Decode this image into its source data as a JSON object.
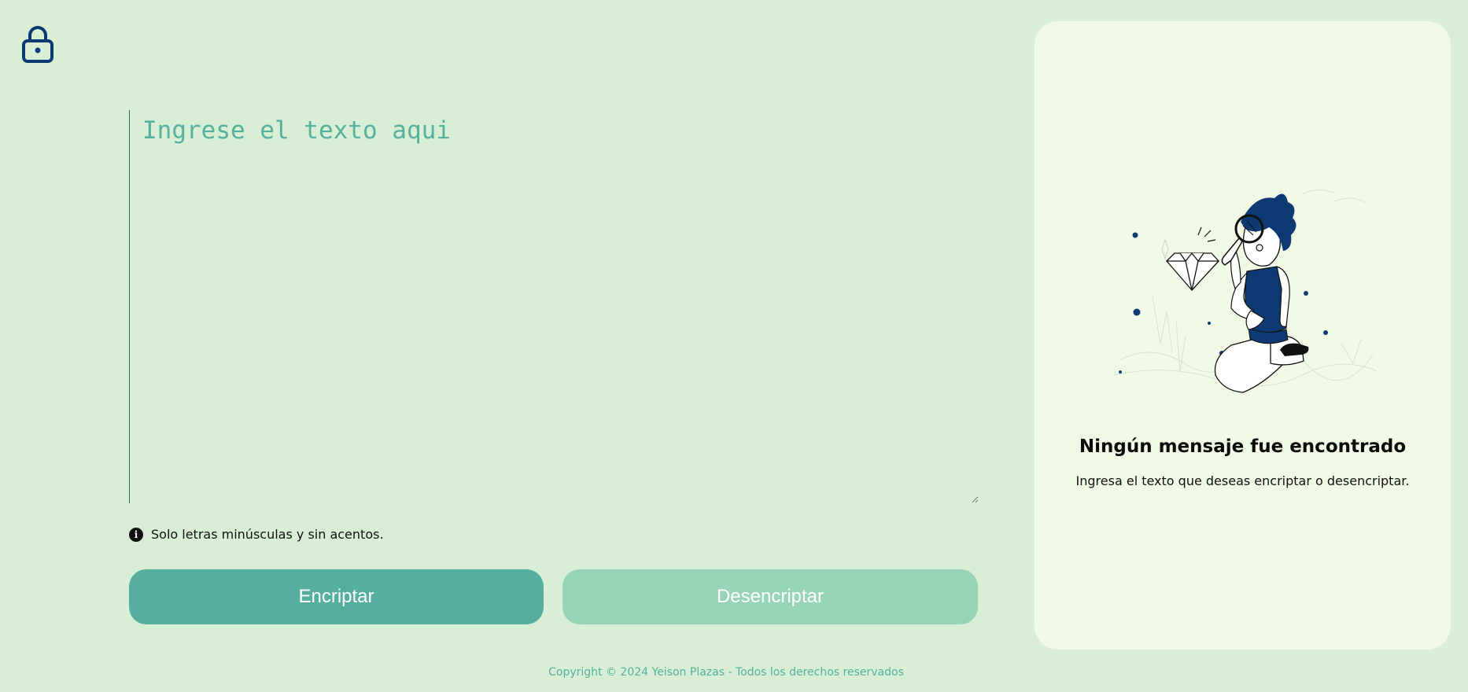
{
  "logo": {
    "icon": "lock-icon",
    "color": "#0e3a73"
  },
  "input": {
    "placeholder": "Ingrese el texto aqui",
    "value": ""
  },
  "hint": {
    "icon": "info-icon",
    "icon_glyph": "i",
    "text": "Solo letras minúsculas y sin acentos."
  },
  "buttons": {
    "encrypt_label": "Encriptar",
    "decrypt_label": "Desencriptar"
  },
  "result_panel": {
    "illustration": "person-with-magnifier-and-diamond",
    "title": "Ningún mensaje fue encontrado",
    "subtitle": "Ingresa el texto que deseas encriptar o desencriptar."
  },
  "footer": {
    "text": "Copyright © 2024 Yeison Plazas - Todos los derechos reservados"
  },
  "colors": {
    "background": "#d9efd5",
    "panel": "#f1f8e6",
    "accent": "#55ae9e",
    "accent_light": "#97d3b6",
    "brand_blue": "#0e3a73"
  }
}
